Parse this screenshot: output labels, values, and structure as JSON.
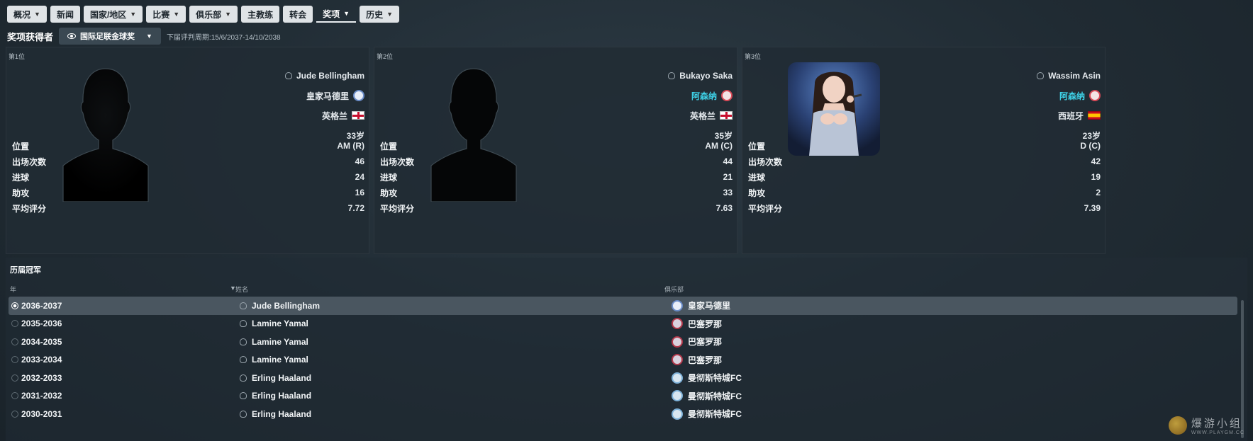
{
  "nav": {
    "items": [
      {
        "label": "概况",
        "chevron": true
      },
      {
        "label": "新闻",
        "chevron": false
      },
      {
        "label": "国家/地区",
        "chevron": true
      },
      {
        "label": "比赛",
        "chevron": true
      },
      {
        "label": "俱乐部",
        "chevron": true
      },
      {
        "label": "主教练",
        "chevron": false
      },
      {
        "label": "转会",
        "chevron": false
      },
      {
        "label": "奖项",
        "chevron": true,
        "active": true
      },
      {
        "label": "历史",
        "chevron": true
      }
    ]
  },
  "award": {
    "label": "奖项获得者",
    "selected": "国际足联金球奖",
    "next_period": "下届评判周期:15/6/2037-14/10/2038"
  },
  "podium": [
    {
      "rank": "第1位",
      "name": "Jude Bellingham",
      "club": "皇家马德里",
      "club_crest": "real-madrid-crest",
      "country": "英格兰",
      "flag": "england-flag",
      "age": "33岁",
      "stats": [
        {
          "label": "位置",
          "value": "AM (R)"
        },
        {
          "label": "出场次数",
          "value": "46"
        },
        {
          "label": "进球",
          "value": "24"
        },
        {
          "label": "助攻",
          "value": "16"
        },
        {
          "label": "平均评分",
          "value": "7.72"
        }
      ]
    },
    {
      "rank": "第2位",
      "name": "Bukayo Saka",
      "club": "阿森纳",
      "club_crest": "arsenal-crest",
      "country": "英格兰",
      "flag": "england-flag",
      "age": "35岁",
      "stats": [
        {
          "label": "位置",
          "value": "AM (C)"
        },
        {
          "label": "出场次数",
          "value": "44"
        },
        {
          "label": "进球",
          "value": "21"
        },
        {
          "label": "助攻",
          "value": "33"
        },
        {
          "label": "平均评分",
          "value": "7.63"
        }
      ]
    },
    {
      "rank": "第3位",
      "name": "Wassim Asin",
      "club": "阿森纳",
      "club_crest": "arsenal-crest",
      "country": "西班牙",
      "flag": "spain-flag",
      "age": "23岁",
      "stats": [
        {
          "label": "位置",
          "value": "D (C)"
        },
        {
          "label": "出场次数",
          "value": "42"
        },
        {
          "label": "进球",
          "value": "19"
        },
        {
          "label": "助攻",
          "value": "2"
        },
        {
          "label": "平均评分",
          "value": "7.39"
        }
      ]
    }
  ],
  "history": {
    "title": "历届冠军",
    "columns": {
      "year": "年",
      "name": "姓名",
      "club": "俱乐部"
    },
    "rows": [
      {
        "year": "2036-2037",
        "name": "Jude Bellingham",
        "club": "皇家马德里",
        "crest": "real-madrid-crest",
        "selected": true
      },
      {
        "year": "2035-2036",
        "name": "Lamine Yamal",
        "club": "巴塞罗那",
        "crest": "barcelona-crest"
      },
      {
        "year": "2034-2035",
        "name": "Lamine Yamal",
        "club": "巴塞罗那",
        "crest": "barcelona-crest"
      },
      {
        "year": "2033-2034",
        "name": "Lamine Yamal",
        "club": "巴塞罗那",
        "crest": "barcelona-crest"
      },
      {
        "year": "2032-2033",
        "name": "Erling Haaland",
        "club": "曼彻斯特城FC",
        "crest": "manchester-city-crest"
      },
      {
        "year": "2031-2032",
        "name": "Erling Haaland",
        "club": "曼彻斯特城FC",
        "crest": "manchester-city-crest"
      },
      {
        "year": "2030-2031",
        "name": "Erling Haaland",
        "club": "曼彻斯特城FC",
        "crest": "manchester-city-crest"
      }
    ]
  },
  "watermark": {
    "text": "爆游小组",
    "sub": "WWW.PLAYGM.CC"
  }
}
